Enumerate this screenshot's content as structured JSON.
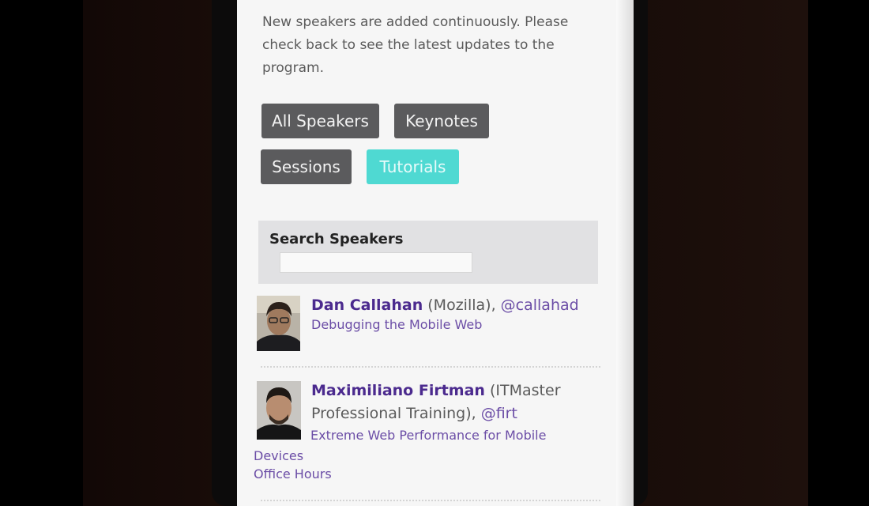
{
  "intro_text": "New speakers are added continuously. Please check back to see the latest updates to the program.",
  "filters": {
    "all": "All Speakers",
    "keynotes": "Keynotes",
    "sessions": "Sessions",
    "tutorials": "Tutorials",
    "active": "Tutorials"
  },
  "search": {
    "label": "Search Speakers",
    "value": "",
    "placeholder": ""
  },
  "speakers": [
    {
      "name": "Dan Callahan",
      "org": " (Mozilla), ",
      "handle": "@callahad",
      "talks": [
        "Debugging the Mobile Web"
      ]
    },
    {
      "name": "Maximiliano Firtman",
      "org": " (ITMaster Professional Training), ",
      "handle": "@firt",
      "talks": [
        "Extreme Web Performance for Mobile Devices",
        "Office Hours"
      ]
    }
  ],
  "colors": {
    "active_filter": "#4fd9d2",
    "filter_button": "#5b5b5d",
    "speaker_name": "#4b2a8e",
    "link": "#6b4da6"
  }
}
